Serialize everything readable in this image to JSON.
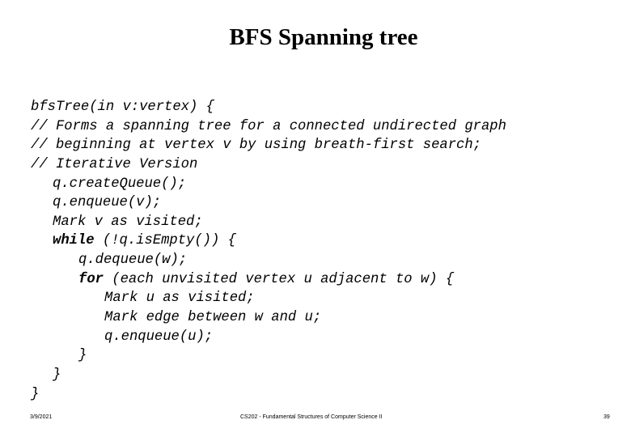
{
  "slide": {
    "title": "BFS Spanning tree",
    "code_lines": [
      {
        "indent": 0,
        "keyword": "",
        "text": "bfsTree(in v:vertex) {"
      },
      {
        "indent": 0,
        "keyword": "",
        "text": "// Forms a spanning tree for a connected undirected graph"
      },
      {
        "indent": 0,
        "keyword": "",
        "text": "// beginning at vertex v by using breath-first search;"
      },
      {
        "indent": 0,
        "keyword": "",
        "text": "// Iterative Version"
      },
      {
        "indent": 1,
        "keyword": "",
        "text": "q.createQueue();"
      },
      {
        "indent": 1,
        "keyword": "",
        "text": "q.enqueue(v);"
      },
      {
        "indent": 1,
        "keyword": "",
        "text": "Mark v as visited;"
      },
      {
        "indent": 1,
        "keyword": "while",
        "text": " (!q.isEmpty()) {"
      },
      {
        "indent": 2,
        "keyword": "",
        "text": "q.dequeue(w);"
      },
      {
        "indent": 2,
        "keyword": "for",
        "text": " (each unvisited vertex u adjacent to w) {"
      },
      {
        "indent": 3,
        "keyword": "",
        "text": "Mark u as visited;"
      },
      {
        "indent": 3,
        "keyword": "",
        "text": "Mark edge between w and u;"
      },
      {
        "indent": 3,
        "keyword": "",
        "text": "q.enqueue(u);"
      },
      {
        "indent": 2,
        "keyword": "",
        "text": "}"
      },
      {
        "indent": 1,
        "keyword": "",
        "text": "}"
      },
      {
        "indent": 0,
        "keyword": "",
        "text": "}"
      }
    ]
  },
  "footer": {
    "date": "3/9/2021",
    "course": "CS202 - Fundamental Structures of Computer Science II",
    "page": "39"
  }
}
